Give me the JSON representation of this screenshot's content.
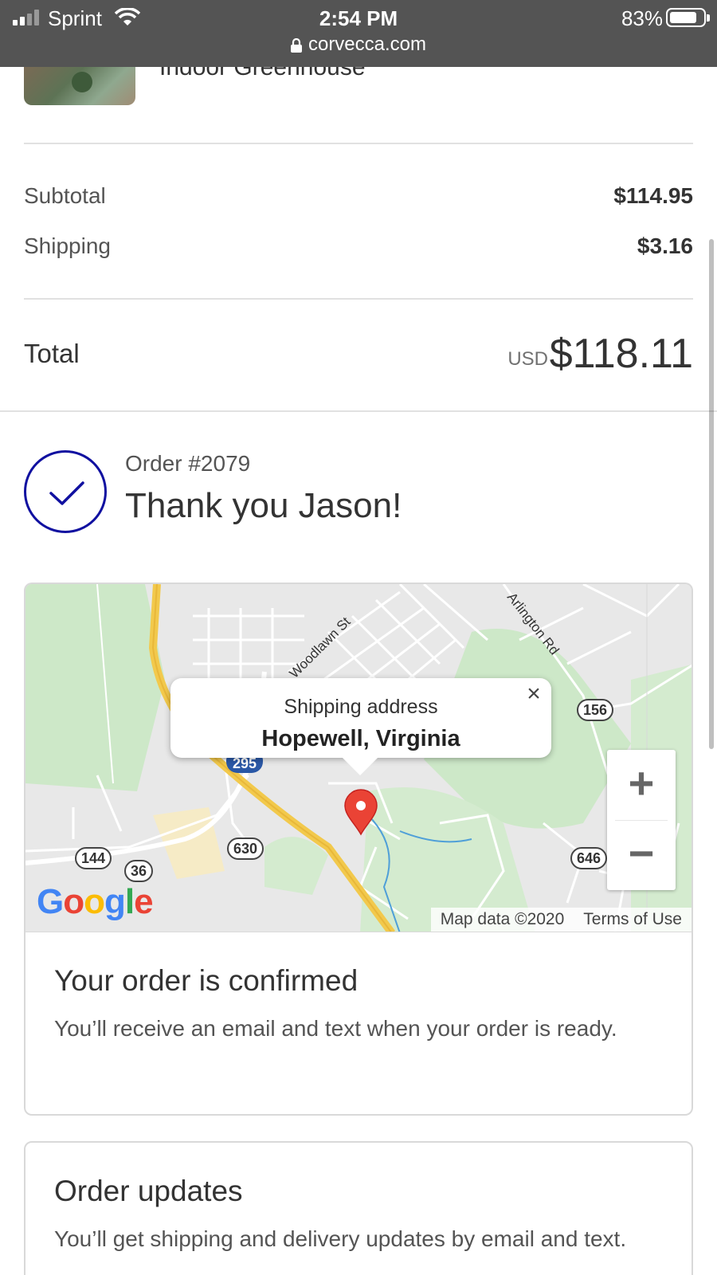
{
  "status_bar": {
    "carrier": "Sprint",
    "time": "2:54 PM",
    "url": "corvecca.com",
    "battery": "83%",
    "battery_level": 0.83
  },
  "product": {
    "name": "Indoor Greenhouse"
  },
  "totals": {
    "subtotal_label": "Subtotal",
    "subtotal_value": "$114.95",
    "shipping_label": "Shipping",
    "shipping_value": "$3.16",
    "total_label": "Total",
    "currency": "USD",
    "total_value": "$118.11"
  },
  "order": {
    "number": "Order #2079",
    "thank_you": "Thank you Jason!",
    "accent_color": "#1010a0"
  },
  "map": {
    "popup_title": "Shipping address",
    "popup_city": "Hopewell, Virginia",
    "close_symbol": "×",
    "zoom_in": "+",
    "zoom_out": "−",
    "logo": "Google",
    "attribution": "Map data ©2020",
    "terms": "Terms of Use",
    "road_labels": [
      "Woodlawn St",
      "Arlington Rd"
    ],
    "route_shields": [
      "156",
      "295",
      "630",
      "144",
      "36",
      "646"
    ],
    "pin_color": "#ea4335"
  },
  "confirmation": {
    "title": "Your order is confirmed",
    "body": "You’ll receive an email and text when your order is ready."
  },
  "updates": {
    "title": "Order updates",
    "body": "You’ll get shipping and delivery updates by email and text."
  }
}
